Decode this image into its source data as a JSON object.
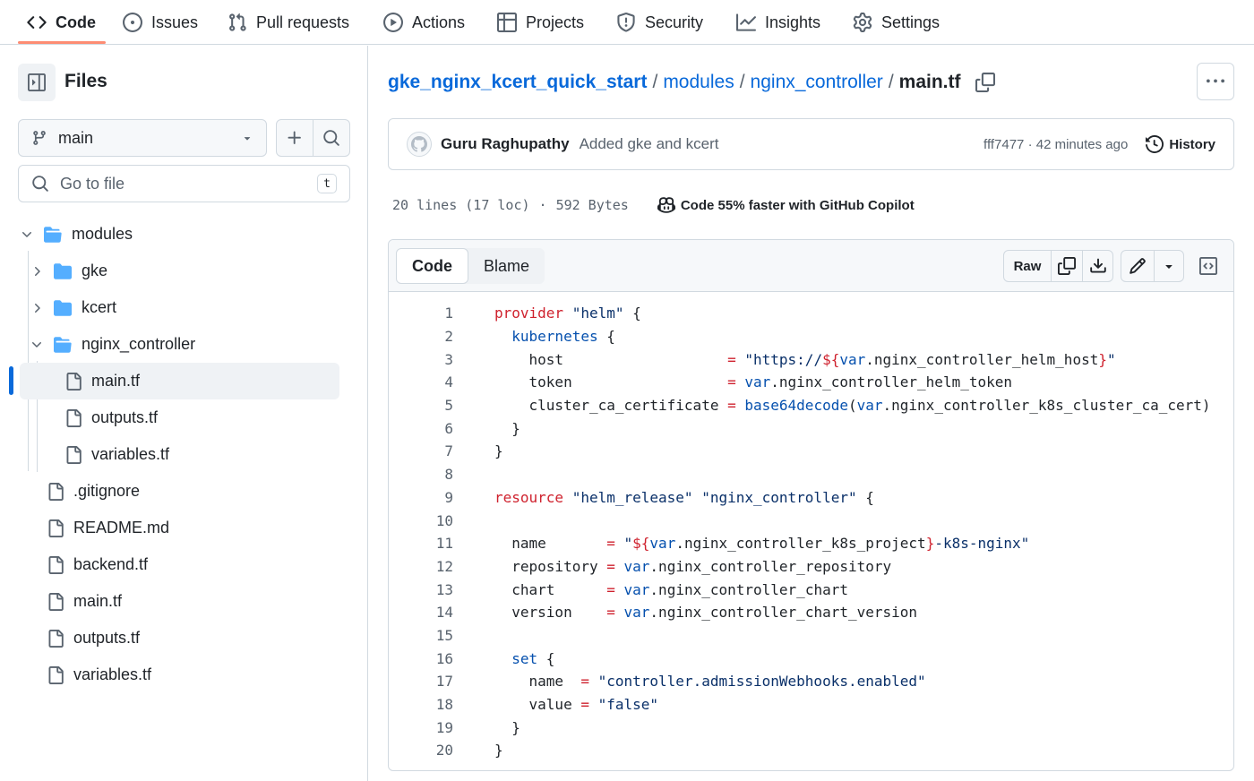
{
  "nav": {
    "tabs": [
      {
        "label": "Code",
        "icon": "code-icon"
      },
      {
        "label": "Issues",
        "icon": "issue-opened-icon"
      },
      {
        "label": "Pull requests",
        "icon": "git-pull-request-icon"
      },
      {
        "label": "Actions",
        "icon": "play-icon"
      },
      {
        "label": "Projects",
        "icon": "table-icon"
      },
      {
        "label": "Security",
        "icon": "shield-icon"
      },
      {
        "label": "Insights",
        "icon": "graph-icon"
      },
      {
        "label": "Settings",
        "icon": "gear-icon"
      }
    ],
    "active_tab": "Code",
    "accent_color": "#fd8c73"
  },
  "sidebar": {
    "title": "Files",
    "branch": "main",
    "search_placeholder": "Go to file",
    "search_shortcut": "t",
    "tree": [
      {
        "name": "modules",
        "type": "folder",
        "expanded": true
      },
      {
        "name": "gke",
        "type": "folder",
        "expanded": false
      },
      {
        "name": "kcert",
        "type": "folder",
        "expanded": false
      },
      {
        "name": "nginx_controller",
        "type": "folder",
        "expanded": true
      },
      {
        "name": "main.tf",
        "type": "file",
        "selected": true
      },
      {
        "name": "outputs.tf",
        "type": "file"
      },
      {
        "name": "variables.tf",
        "type": "file"
      },
      {
        "name": ".gitignore",
        "type": "file"
      },
      {
        "name": "README.md",
        "type": "file"
      },
      {
        "name": "backend.tf",
        "type": "file"
      },
      {
        "name": "main.tf",
        "type": "file"
      },
      {
        "name": "outputs.tf",
        "type": "file"
      },
      {
        "name": "variables.tf",
        "type": "file"
      }
    ]
  },
  "breadcrumb": {
    "repo": "gke_nginx_kcert_quick_start",
    "dir1": "modules",
    "dir2": "nginx_controller",
    "file": "main.tf"
  },
  "commit": {
    "author": "Guru Raghupathy",
    "message": "Added gke and kcert",
    "sha": "fff7477",
    "time": "42 minutes ago",
    "history_label": "History"
  },
  "file_info": {
    "lines": "20 lines (17 loc)",
    "size": "592 Bytes",
    "copilot": "Code 55% faster with GitHub Copilot"
  },
  "code_view": {
    "tab_code": "Code",
    "tab_blame": "Blame",
    "raw_label": "Raw",
    "lines": [
      "1",
      "2",
      "3",
      "4",
      "5",
      "6",
      "7",
      "8",
      "9",
      "10",
      "11",
      "12",
      "13",
      "14",
      "15",
      "16",
      "17",
      "18",
      "19",
      "20"
    ]
  },
  "colors": {
    "link": "#0969da",
    "keyword": "#cf222e",
    "string": "#0a3069",
    "property": "#0550ae",
    "function": "#6639ba",
    "folder": "#54aeff"
  }
}
